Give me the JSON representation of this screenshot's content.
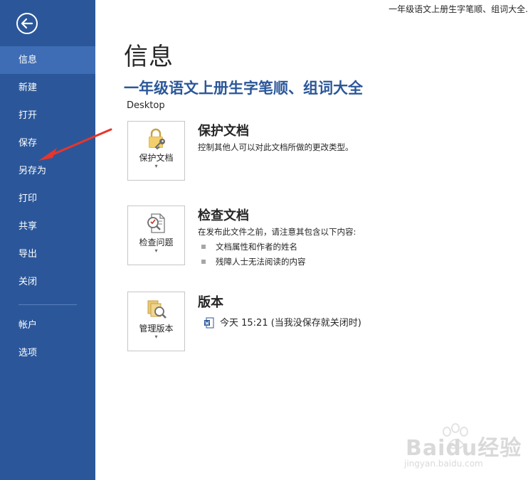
{
  "window": {
    "title": "一年级语文上册生字笔顺、组词大全."
  },
  "sidebar": {
    "back_icon": "back-arrow-icon",
    "items": [
      {
        "label": "信息",
        "active": true
      },
      {
        "label": "新建"
      },
      {
        "label": "打开"
      },
      {
        "label": "保存"
      },
      {
        "label": "另存为"
      },
      {
        "label": "打印"
      },
      {
        "label": "共享"
      },
      {
        "label": "导出"
      },
      {
        "label": "关闭"
      },
      {
        "label": "帐户"
      },
      {
        "label": "选项"
      }
    ],
    "colors": {
      "background": "#2b579a",
      "active": "#3e6db5"
    }
  },
  "main": {
    "page_title": "信息",
    "doc_title": "一年级语文上册生字笔顺、组词大全",
    "doc_location": "Desktop",
    "sections": [
      {
        "tile_label": "保护文档",
        "tile_icon": "lock-key-icon",
        "heading": "保护文档",
        "description": "控制其他人可以对此文档所做的更改类型。"
      },
      {
        "tile_label": "检查问题",
        "tile_icon": "inspect-document-icon",
        "heading": "检查文档",
        "description": "在发布此文件之前，请注意其包含以下内容:",
        "bullets": [
          "文档属性和作者的姓名",
          "残障人士无法阅读的内容"
        ]
      },
      {
        "tile_label": "管理版本",
        "tile_icon": "manage-versions-icon",
        "heading": "版本",
        "versions": [
          {
            "icon": "word-doc-icon",
            "label": "今天 15:21 (当我没保存就关闭时)"
          }
        ]
      }
    ]
  },
  "watermark": {
    "text": "Baidu经验",
    "url": "jingyan.baidu.com"
  }
}
